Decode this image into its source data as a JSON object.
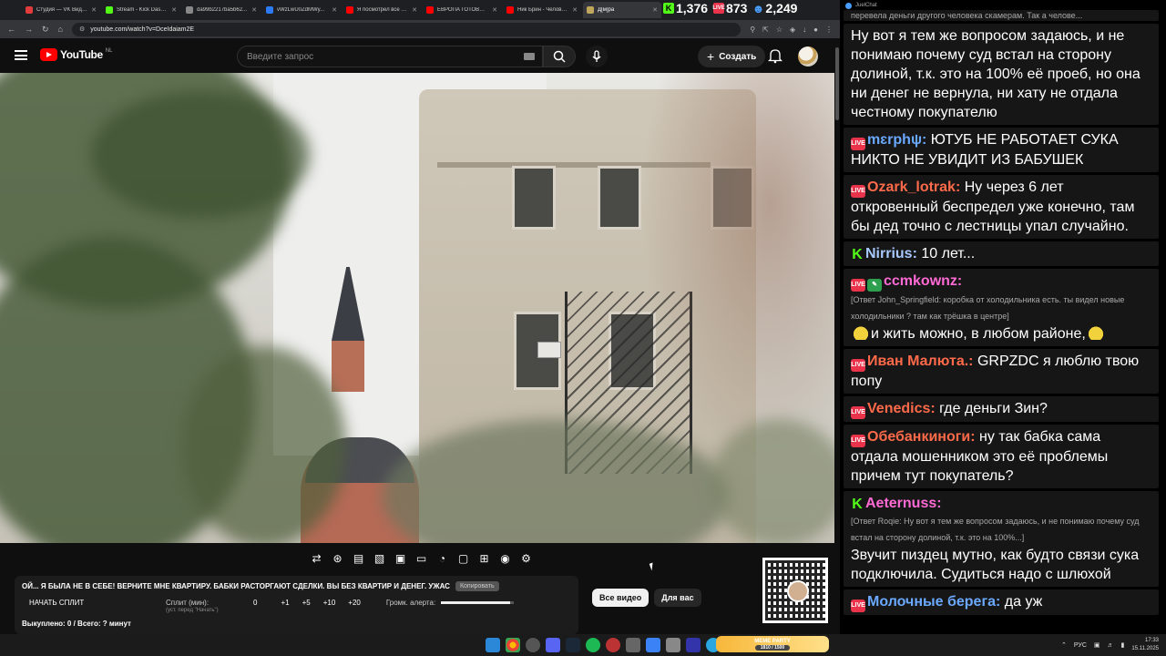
{
  "browser": {
    "tabs": [
      {
        "label": "Студия — VK Видео",
        "color": "#e23b3b",
        "active": false
      },
      {
        "label": "Stream - Kick Dashboard",
        "color": "#53fc18",
        "active": false
      },
      {
        "label": "da99b2217ba5b62...",
        "color": "#888888",
        "active": false
      },
      {
        "label": "vWzLwU0ZdMWy...",
        "color": "#2d7bf4",
        "active": false
      },
      {
        "label": "Я посмотрел все Х...",
        "color": "#ff0000",
        "active": false
      },
      {
        "label": "ЕВРОПА ГОТОВИТ...",
        "color": "#ff0000",
        "active": false
      },
      {
        "label": "Ник Брин - Челове...",
        "color": "#ff0000",
        "active": false
      },
      {
        "label": "Д[м]ра",
        "color": "#bfa65a",
        "active": true
      }
    ],
    "url": "youtube.com/watch?v=DceIdaiam2E",
    "stats": {
      "kick": "1,376",
      "live": "873",
      "viewers": "2,249"
    }
  },
  "youtube": {
    "logo_text": "YouTube",
    "region": "NL",
    "search_placeholder": "Введите запрос",
    "create_label": "Создать",
    "chips": [
      "Все видео",
      "Для вас"
    ]
  },
  "stream_panel": {
    "title": "ОЙ... Я БЫЛА НЕ В СЕБЕ! ВЕРНИТЕ МНЕ КВАРТИРУ. БАБКИ РАСТОРГАЮТ СДЕЛКИ. ВЫ БЕЗ КВАРТИР И ДЕНЕГ. УЖАС",
    "copy_label": "Копировать",
    "start_split": "НАЧАТЬ СПЛИТ",
    "split_label": "Сплит (мин):",
    "split_hint": "(уст. перед \"Начать\")",
    "split_value": "0",
    "increments": [
      "+1",
      "+5",
      "+10",
      "+20"
    ],
    "alert_volume_label": "Громк. алерта:",
    "alert_volume": 0.95,
    "totals": "Выкуплено: 0 / Всего: ? минут"
  },
  "chat": {
    "header": "JuelChat",
    "top_partial": "перевела деньги другого человека скамерам. Так а челове...",
    "messages": [
      {
        "platform": "",
        "user": "",
        "user_color": "#ffffff",
        "reply": "",
        "text": "Ну вот я тем же вопросом задаюсь, и не понимаю почему суд встал на сторону долиной, т.к. это на 100% её проеб, но она ни денег не вернула, ни хату не отдала честному покупателю"
      },
      {
        "platform": "yt",
        "user": "mɛrphψ:",
        "user_color": "#6aa9ff",
        "reply": "",
        "text": "ЮТУБ НЕ РАБОТАЕТ СУКА НИКТО НЕ УВИДИТ ИЗ БАБУШЕК"
      },
      {
        "platform": "yt",
        "user": "Ozark_lotrak:",
        "user_color": "#ff6a4a",
        "reply": "",
        "text": "Ну через 6 лет откровенный беспредел уже конечно, там бы дед точно с лестницы упал случайно."
      },
      {
        "platform": "k",
        "user": "Nirrius:",
        "user_color": "#a8c8ff",
        "reply": "",
        "text": "10 лет..."
      },
      {
        "platform": "yt",
        "user": "ccmkownz:",
        "user_color": "#ff6ad5",
        "reply": "[Ответ John_Springfield: коробка от холодильника есть. ты видел новые холодильники ? там как трёшка в центре]",
        "text": "и жить можно, в любом районе,"
      },
      {
        "platform": "yt",
        "user": "Иван Малюта.:",
        "user_color": "#ff6a4a",
        "reply": "",
        "text": "GRPZDC я люблю твою попу"
      },
      {
        "platform": "yt",
        "user": "Venedics:",
        "user_color": "#ff6a4a",
        "reply": "",
        "text": "где деньги Зин?"
      },
      {
        "platform": "yt",
        "user": "Обебанкиноги:",
        "user_color": "#ff6a4a",
        "reply": "",
        "text": "ну так бабка сама отдала мошенником это её проблемы причем тут покупатель?"
      },
      {
        "platform": "k",
        "user": "Aeternuss:",
        "user_color": "#ff6ad5",
        "reply": "[Ответ Roqie: Ну вот я тем же вопросом задаюсь, и не понимаю почему суд встал на сторону долиной, т.к. это на 100%...]",
        "text": "Звучит пиздец мутно, как будто связи сука подключила. Судиться надо с шлюхой"
      },
      {
        "platform": "yt",
        "user": "Молочные берега:",
        "user_color": "#6aa9ff",
        "reply": "",
        "text": "да уж"
      }
    ]
  },
  "taskbar": {
    "meme_label": "MEME PARTY",
    "meme_progress": "1810 / 1500",
    "lang": "РУС",
    "time": "17:33",
    "date": "15.11.2025"
  }
}
